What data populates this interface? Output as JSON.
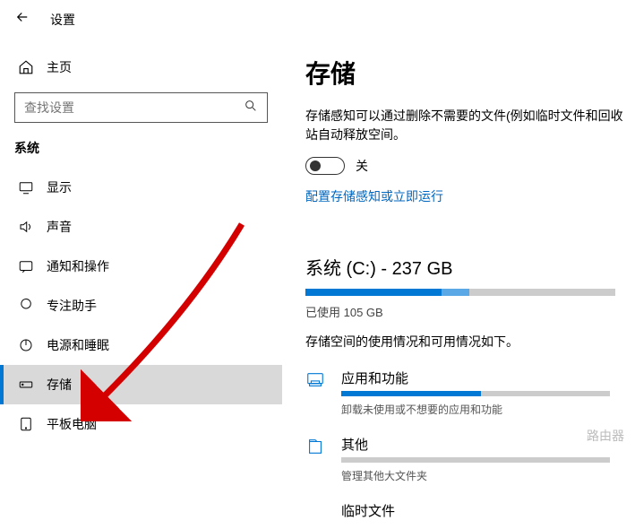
{
  "header": {
    "title": "设置"
  },
  "sidebar": {
    "home": "主页",
    "search_placeholder": "查找设置",
    "section": "系统",
    "items": [
      {
        "label": "显示"
      },
      {
        "label": "声音"
      },
      {
        "label": "通知和操作"
      },
      {
        "label": "专注助手"
      },
      {
        "label": "电源和睡眠"
      },
      {
        "label": "存储"
      },
      {
        "label": "平板电脑"
      }
    ]
  },
  "main": {
    "title": "存储",
    "description": "存储感知可以通过删除不需要的文件(例如临时文件和回收站自动释放空间。",
    "toggle_label": "关",
    "configure_link": "配置存储感知或立即运行",
    "drive_title": "系统 (C:) - 237 GB",
    "used_text": "已使用 105 GB",
    "usage_desc": "存储空间的使用情况和可用情况如下。",
    "categories": [
      {
        "title": "应用和功能",
        "sub": "卸载未使用或不想要的应用和功能",
        "fill": 52
      },
      {
        "title": "其他",
        "sub": "管理其他大文件夹",
        "fill": 0
      },
      {
        "title": "临时文件",
        "sub": "",
        "fill": 0
      }
    ]
  },
  "watermark": "路由器"
}
